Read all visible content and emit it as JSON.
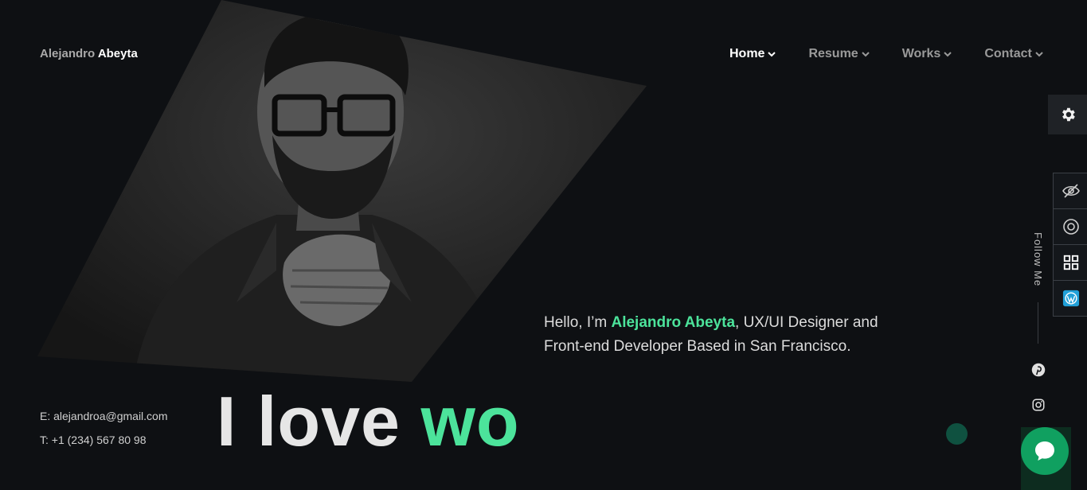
{
  "brand": {
    "first": "Alejandro",
    "last": "Abeyta"
  },
  "nav": [
    {
      "label": "Home",
      "active": true
    },
    {
      "label": "Resume",
      "active": false
    },
    {
      "label": "Works",
      "active": false
    },
    {
      "label": "Contact",
      "active": false
    }
  ],
  "intro": {
    "prefix": "Hello, I’m ",
    "name": "Alejandro Abeyta",
    "suffix": ", UX/UI Designer and Front-end Developer Based in San Francisco."
  },
  "contact": {
    "email": "E: alejandroa@gmail.com",
    "phone": "T: +1 (234) 567 80 98"
  },
  "hero": {
    "text_white": "I love ",
    "text_accent": "wo"
  },
  "side": {
    "follow": "Follow Me"
  },
  "colors": {
    "accent": "#4ce39b",
    "background": "#0e1013",
    "chat": "#10a060"
  },
  "icons": [
    "gear-icon",
    "hide-icon",
    "help-icon",
    "grid-icon",
    "wordpress-icon",
    "pinterest-icon",
    "instagram-icon",
    "chat-icon"
  ]
}
